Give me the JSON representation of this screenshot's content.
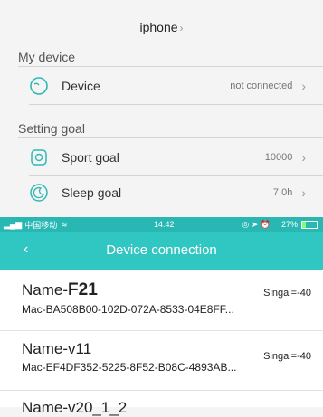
{
  "header": {
    "link_label": "iphone",
    "chevron": "›"
  },
  "my_device": {
    "section_title": "My device",
    "device_row": {
      "label": "Device",
      "value": "not connected",
      "arrow": "›",
      "icon": "device-circle-icon"
    }
  },
  "setting_goal": {
    "section_title": "Setting goal",
    "sport_row": {
      "label": "Sport goal",
      "value": "10000",
      "arrow": "›",
      "icon": "sport-icon"
    },
    "sleep_row": {
      "label": "Sleep goal",
      "value": "7.0h",
      "arrow": "›",
      "icon": "sleep-moon-icon"
    }
  },
  "status_bar": {
    "carrier": "中国移动",
    "time": "14:42",
    "battery": "27%"
  },
  "nav": {
    "back": "‹",
    "title": "Device connection"
  },
  "devices": [
    {
      "name_prefix": "Name-",
      "name_main": "F21",
      "signal": "Singal=-40",
      "mac": "Mac-BA508B00-102D-072A-8533-04E8FF..."
    },
    {
      "name_prefix": "Name-",
      "name_main": "v11",
      "signal": "Singal=-40",
      "mac": "Mac-EF4DF352-5225-8F52-B08C-4893AB..."
    },
    {
      "name_prefix": "Name-",
      "name_main": "v20_1_2",
      "signal": "",
      "mac": ""
    }
  ],
  "colors": {
    "teal": "#30c6c2",
    "teal_dark": "#28b7b2",
    "icon": "#30b8b4"
  }
}
